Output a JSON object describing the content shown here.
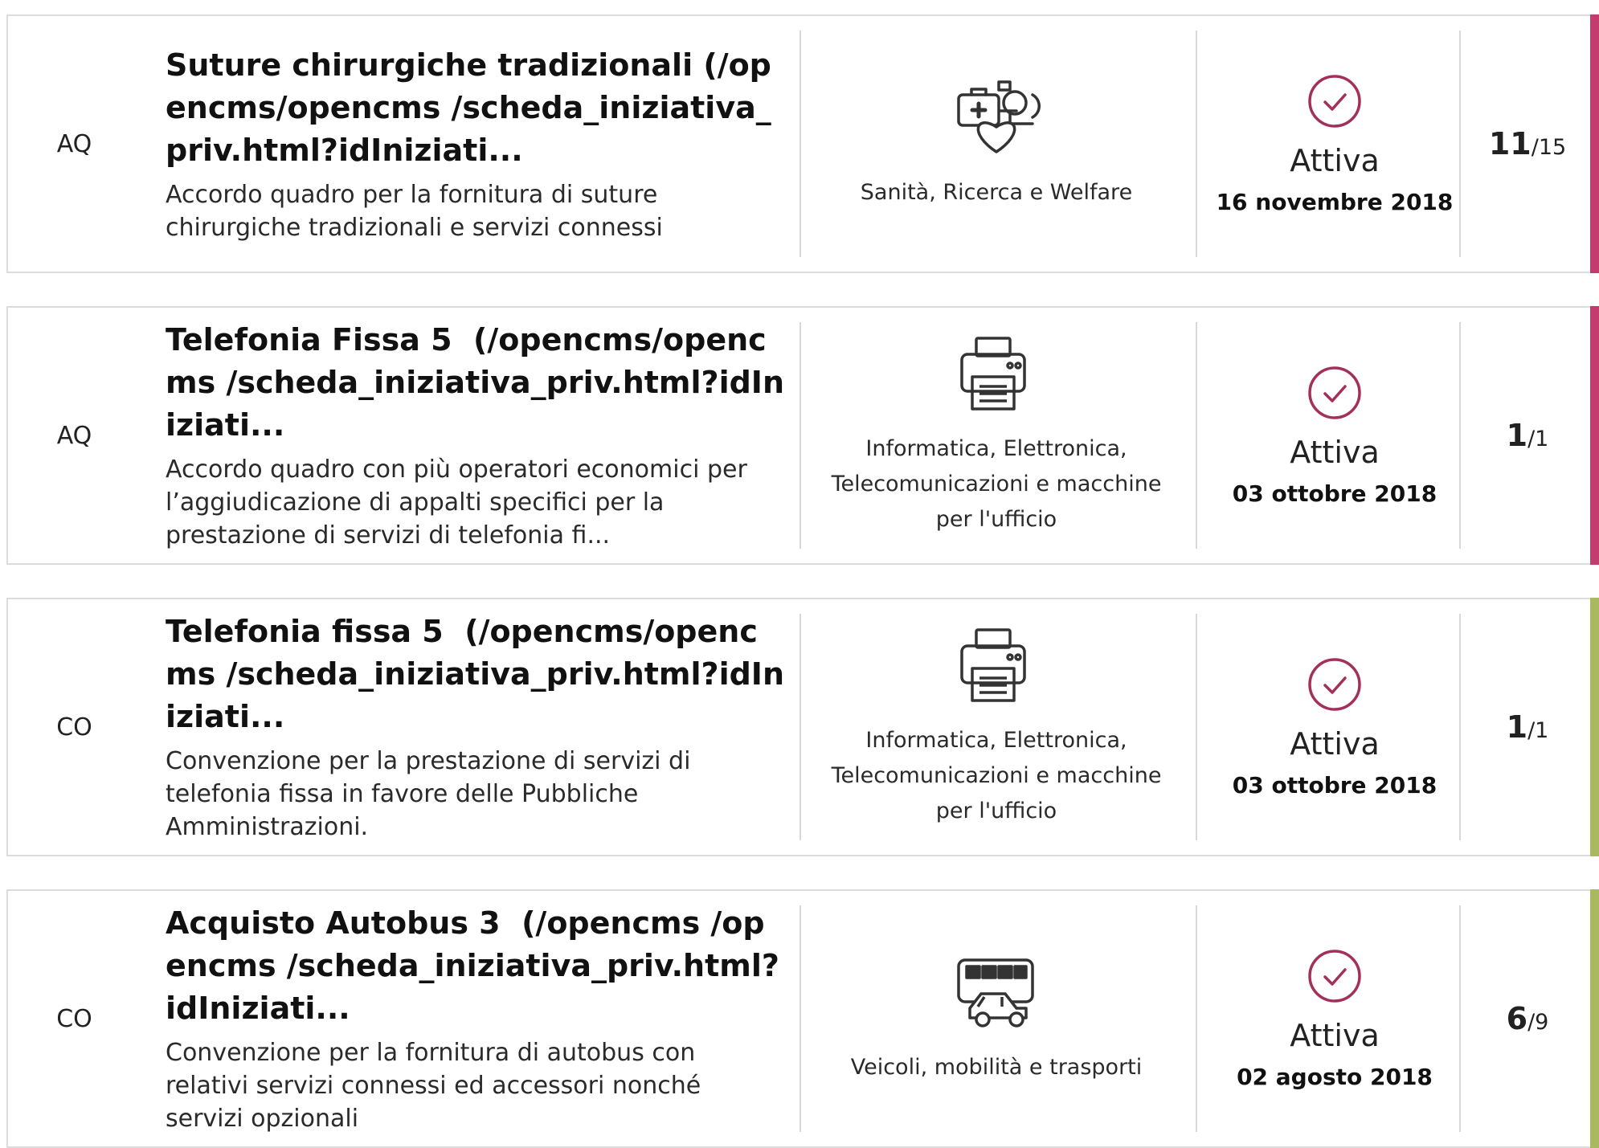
{
  "colors": {
    "accent_pink": "#c43c6f",
    "accent_green": "#a8b960",
    "status_icon": "#a3305a"
  },
  "initiatives": [
    {
      "type": "AQ",
      "title": "Suture chirurgiche tradizionali (/opencms/opencms /scheda_iniziativa_priv.html?idIniziati...",
      "description": "Accordo quadro per la fornitura di suture chirurgiche tradizionali e servizi connessi",
      "category_icon": "healthcare-icon",
      "category": "Sanità, Ricerca e Welfare",
      "status": "Attiva",
      "date": "16 novembre 2018",
      "count_main": "11",
      "count_total": "/15",
      "accent": "#c43c6f"
    },
    {
      "type": "AQ",
      "title": "Telefonia Fissa 5  (/opencms/opencms /scheda_iniziativa_priv.html?idIniziati...",
      "description": "Accordo quadro con più operatori economici per l’aggiudicazione di appalti specifici per la prestazione di servizi di telefonia fi...",
      "category_icon": "printer-icon",
      "category": "Informatica, Elettronica, Telecomunicazioni e macchine per l'ufficio",
      "status": "Attiva",
      "date": "03 ottobre 2018",
      "count_main": "1",
      "count_total": "/1",
      "accent": "#c43c6f"
    },
    {
      "type": "CO",
      "title": "Telefonia fissa 5  (/opencms/opencms /scheda_iniziativa_priv.html?idIniziati...",
      "description": "Convenzione per la prestazione di servizi di telefonia fissa in favore delle Pubbliche Amministrazioni.",
      "category_icon": "printer-icon",
      "category": "Informatica, Elettronica, Telecomunicazioni e macchine per l'ufficio",
      "status": "Attiva",
      "date": "03 ottobre 2018",
      "count_main": "1",
      "count_total": "/1",
      "accent": "#a8b960"
    },
    {
      "type": "CO",
      "title": "Acquisto Autobus 3  (/opencms /opencms /scheda_iniziativa_priv.html?idIniziati...",
      "description": "Convenzione per la fornitura di autobus con relativi servizi connessi ed accessori nonché servizi opzionali",
      "category_icon": "vehicles-icon",
      "category": "Veicoli, mobilità e trasporti",
      "status": "Attiva",
      "date": "02 agosto 2018",
      "count_main": "6",
      "count_total": "/9",
      "accent": "#a8b960"
    }
  ]
}
